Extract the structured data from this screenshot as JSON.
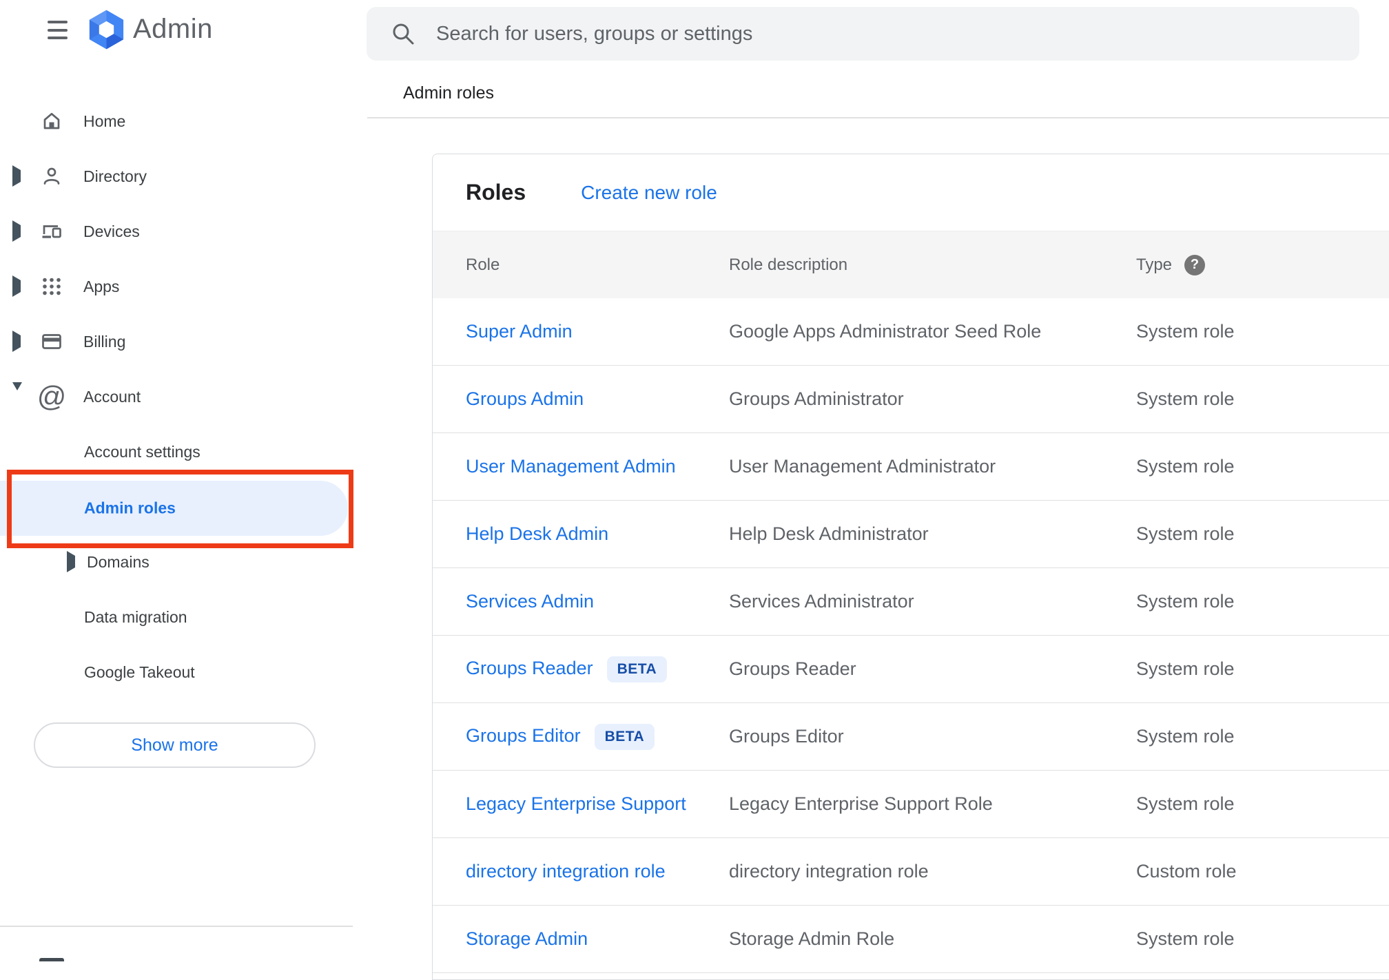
{
  "topbar": {
    "app_title": "Admin"
  },
  "search": {
    "placeholder": "Search for users, groups or settings"
  },
  "breadcrumb": "Admin roles",
  "sidebar": {
    "items": [
      {
        "label": "Home",
        "icon": "home-icon",
        "expand": "none"
      },
      {
        "label": "Directory",
        "icon": "person-icon",
        "expand": "collapsed"
      },
      {
        "label": "Devices",
        "icon": "devices-icon",
        "expand": "collapsed"
      },
      {
        "label": "Apps",
        "icon": "apps-grid-icon",
        "expand": "collapsed"
      },
      {
        "label": "Billing",
        "icon": "credit-card-icon",
        "expand": "collapsed"
      },
      {
        "label": "Account",
        "icon": "at-sign-icon",
        "expand": "expanded"
      }
    ],
    "sub_items": [
      {
        "label": "Account settings",
        "selected": false
      },
      {
        "label": "Admin roles",
        "selected": true
      },
      {
        "label": "Domains",
        "expand": "collapsed"
      },
      {
        "label": "Data migration"
      },
      {
        "label": "Google Takeout"
      }
    ],
    "show_more_label": "Show more",
    "at_glyph": "@"
  },
  "annotation": {
    "type": "red-highlight-box",
    "target": "Admin roles"
  },
  "main": {
    "card_title": "Roles",
    "create_link": "Create new role",
    "columns": [
      "Role",
      "Role description",
      "Type"
    ],
    "help_glyph": "?",
    "rows": [
      {
        "role": "Super Admin",
        "beta": "",
        "description": "Google Apps Administrator Seed Role",
        "type": "System role"
      },
      {
        "role": "Groups Admin",
        "beta": "",
        "description": "Groups Administrator",
        "type": "System role"
      },
      {
        "role": "User Management Admin",
        "beta": "",
        "description": "User Management Administrator",
        "type": "System role"
      },
      {
        "role": "Help Desk Admin",
        "beta": "",
        "description": "Help Desk Administrator",
        "type": "System role"
      },
      {
        "role": "Services Admin",
        "beta": "",
        "description": "Services Administrator",
        "type": "System role"
      },
      {
        "role": "Groups Reader",
        "beta": "BETA",
        "description": "Groups Reader",
        "type": "System role"
      },
      {
        "role": "Groups Editor",
        "beta": "BETA",
        "description": "Groups Editor",
        "type": "System role"
      },
      {
        "role": "Legacy Enterprise Support",
        "beta": "",
        "description": "Legacy Enterprise Support Role",
        "type": "System role"
      },
      {
        "role": "directory integration role",
        "beta": "",
        "description": "directory integration role",
        "type": "Custom role"
      },
      {
        "role": "Storage Admin",
        "beta": "",
        "description": "Storage Admin Role",
        "type": "System role"
      }
    ]
  },
  "colors": {
    "accent_blue": "#1a73e8",
    "beta_text_blue": "#174ea6",
    "beta_bg": "#e8f0fe",
    "selected_pill_bg": "#e8f0fe",
    "annotation_red": "#ee3b17",
    "text_dark": "#202124",
    "text_gray": "#5f6368",
    "sidebar_text": "#3c4043",
    "table_header_bg": "#f5f5f5",
    "search_bg": "#f1f3f4",
    "divider": "#e0e0e0",
    "card_border": "#dadce0",
    "logo_blue": "#4285f4"
  }
}
